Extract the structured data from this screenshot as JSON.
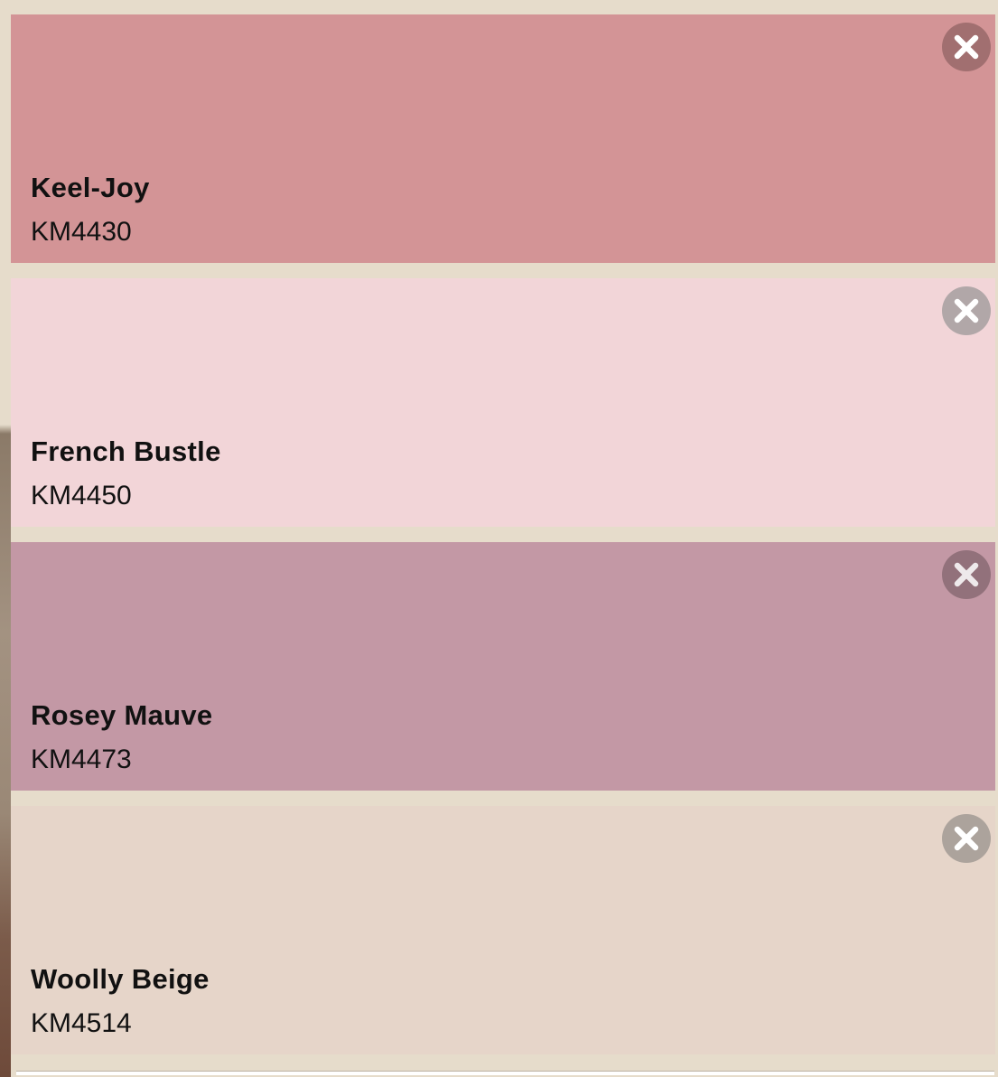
{
  "swatches": [
    {
      "name": "Keel-Joy",
      "code": "KM4430",
      "color": "#d39496",
      "icon_color": "#9b6a6c"
    },
    {
      "name": "French Bustle",
      "code": "KM4450",
      "color": "#f2d5d8",
      "icon_color": "#aaa2a3"
    },
    {
      "name": "Rosey Mauve",
      "code": "KM4473",
      "color": "#c398a5",
      "icon_color": "#8d6d77"
    },
    {
      "name": "Woolly Beige",
      "code": "KM4514",
      "color": "#e6d5c9",
      "icon_color": "#a59d97"
    }
  ],
  "remove_icon": "close-circle-icon",
  "background_color": "#e6dccb"
}
